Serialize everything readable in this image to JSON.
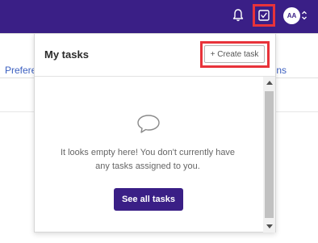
{
  "topbar": {
    "icons": [
      "bell-icon",
      "task-checkbox-icon",
      "chevron-up-down-icon"
    ],
    "avatar_initials": "AA",
    "colors": {
      "bar": "#3a1f86",
      "highlight": "#e8333a"
    }
  },
  "background": {
    "left_link_fragment": "Prefere",
    "right_link_fragment": "ns"
  },
  "panel": {
    "title": "My tasks",
    "create_button_label": "+ Create task",
    "empty_icon": "speech-bubble-icon",
    "empty_message": "It looks empty here! You don't currently have any tasks assigned to you.",
    "see_all_label": "See all tasks"
  }
}
